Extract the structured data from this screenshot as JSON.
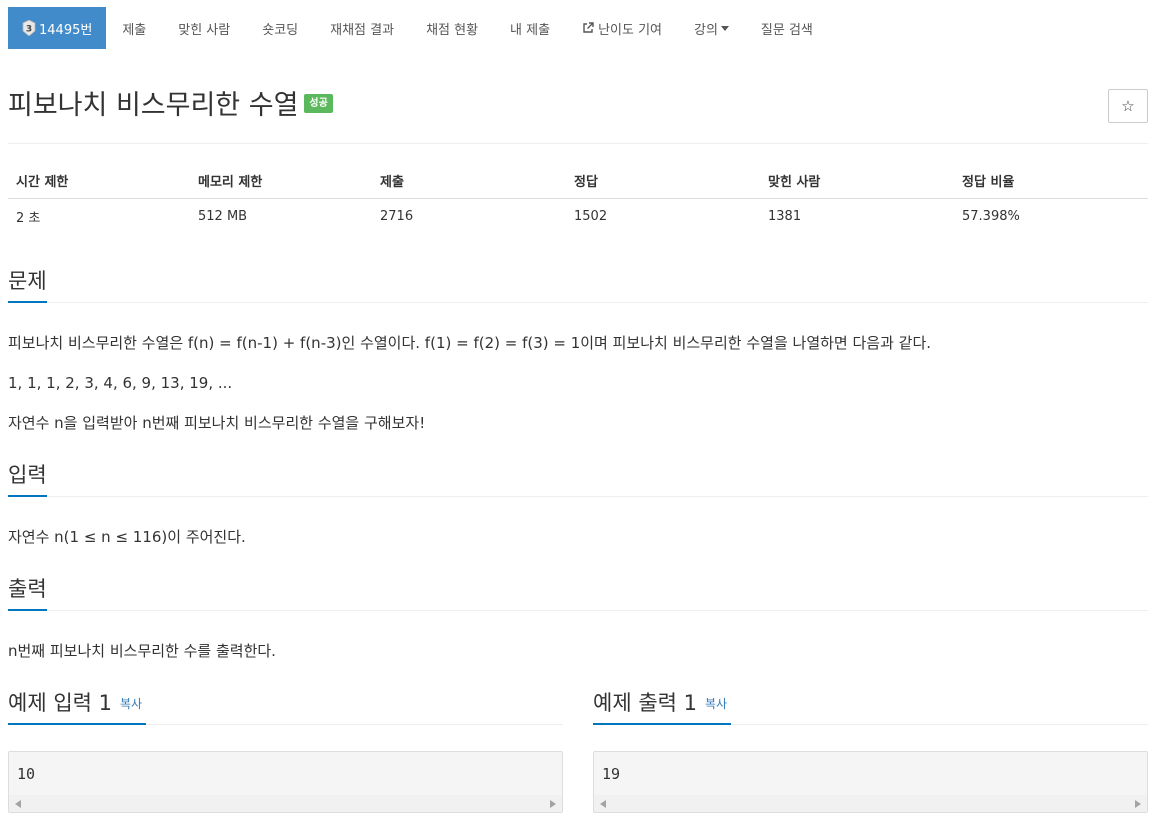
{
  "nav": {
    "problem_number": "14495번",
    "tier_level": "3",
    "items": [
      {
        "label": "제출"
      },
      {
        "label": "맞힌 사람"
      },
      {
        "label": "숏코딩"
      },
      {
        "label": "재채점 결과"
      },
      {
        "label": "채점 현황"
      },
      {
        "label": "내 제출"
      },
      {
        "label": "난이도 기여"
      },
      {
        "label": "강의"
      },
      {
        "label": "질문 검색"
      }
    ]
  },
  "problem": {
    "title": "피보나치 비스무리한 수열",
    "status": "성공",
    "star_icon": "☆"
  },
  "info": {
    "headers": [
      "시간 제한",
      "메모리 제한",
      "제출",
      "정답",
      "맞힌 사람",
      "정답 비율"
    ],
    "values": [
      "2 초",
      "512 MB",
      "2716",
      "1502",
      "1381",
      "57.398%"
    ]
  },
  "sections": {
    "problem": {
      "title": "문제",
      "p1": "피보나치 비스무리한 수열은 f(n) = f(n-1) + f(n-3)인 수열이다. f(1) = f(2) = f(3) = 1이며 피보나치 비스무리한 수열을 나열하면 다음과 같다.",
      "p2": "1, 1, 1, 2, 3, 4, 6, 9, 13, 19, ...",
      "p3": "자연수 n을 입력받아 n번째 피보나치 비스무리한 수열을 구해보자!"
    },
    "input": {
      "title": "입력",
      "p1": "자연수 n(1 ≤ n ≤ 116)이 주어진다."
    },
    "output": {
      "title": "출력",
      "p1": "n번째 피보나치 비스무리한 수를 출력한다."
    }
  },
  "samples": {
    "input_title": "예제 입력 1",
    "output_title": "예제 출력 1",
    "copy_label": "복사",
    "input_value": "10",
    "output_value": "19"
  }
}
